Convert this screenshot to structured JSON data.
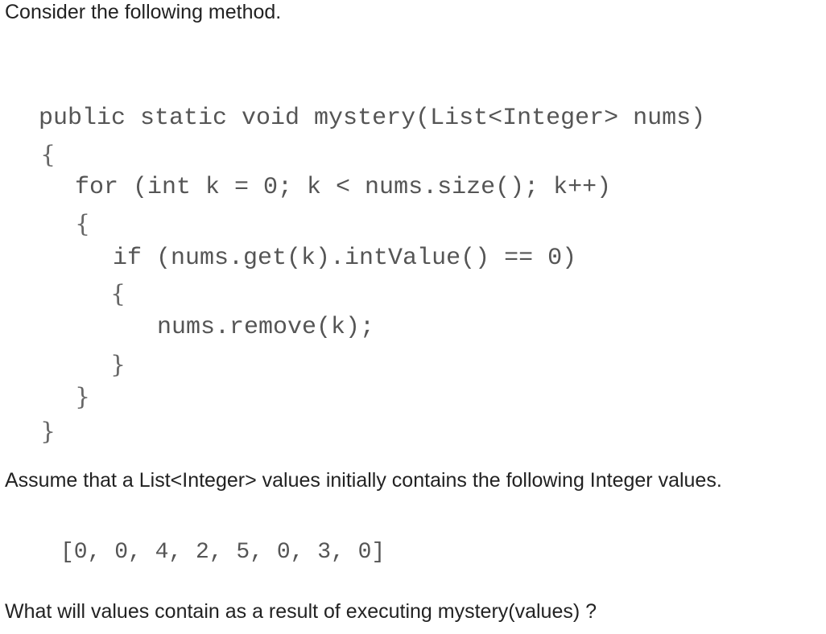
{
  "intro_text": "Consider the following method.",
  "code": {
    "signature": "public static void mystery(List<Integer> nums)",
    "open_brace_method": "{",
    "for_line": "for (int k = 0; k < nums.size(); k++)",
    "open_brace_for": "{",
    "if_line": "if (nums.get(k).intValue() == 0)",
    "open_brace_if": "{",
    "remove_line": "nums.remove(k);",
    "close_brace_if": "}",
    "close_brace_for": "}",
    "close_brace_method": "}"
  },
  "assume_text": "Assume that a List<Integer> values initially contains the following Integer values.",
  "initial_values": "[0, 0, 4, 2, 5, 0, 3, 0]",
  "question_text": "What will values contain as a result of executing mystery(values) ?"
}
